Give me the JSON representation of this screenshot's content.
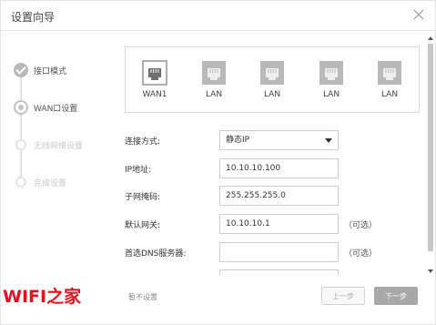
{
  "dialog": {
    "title": "设置向导",
    "close_icon": "close-icon"
  },
  "steps": [
    {
      "label": "接口模式",
      "state": "done",
      "color": "#555555"
    },
    {
      "label": "WAN口设置",
      "state": "current",
      "color": "#555555"
    },
    {
      "label": "无线网络设置",
      "state": "todo",
      "color": "#c8c8c8"
    },
    {
      "label": "完成设置",
      "state": "todo",
      "color": "#c8c8c8"
    }
  ],
  "ports": [
    {
      "label": "WAN1",
      "icon": "ethernet-port-icon",
      "selected": true
    },
    {
      "label": "LAN",
      "icon": "ethernet-port-icon",
      "selected": false
    },
    {
      "label": "LAN",
      "icon": "ethernet-port-icon",
      "selected": false
    },
    {
      "label": "LAN",
      "icon": "ethernet-port-icon",
      "selected": false
    },
    {
      "label": "LAN",
      "icon": "ethernet-port-icon",
      "selected": false
    }
  ],
  "form": {
    "connection_type": {
      "label": "连接方式:",
      "value": "静态IP"
    },
    "ip_address": {
      "label": "IP地址:",
      "value": "10.10.10.100"
    },
    "subnet_mask": {
      "label": "子网掩码:",
      "value": "255.255.255.0"
    },
    "gateway": {
      "label": "默认网关:",
      "value": "10.10.10.1",
      "note": "（可选）"
    },
    "primary_dns": {
      "label": "首选DNS服务器:",
      "value": "",
      "note": "（可选）"
    },
    "secondary_dns": {
      "value": ""
    }
  },
  "footer": {
    "skip": "暂不设置",
    "prev": "上一步",
    "next": "下一步"
  },
  "watermark": "WIFI之家",
  "colors": {
    "accent_gray": "#a8a8a8",
    "watermark_red": "#e8101e"
  }
}
